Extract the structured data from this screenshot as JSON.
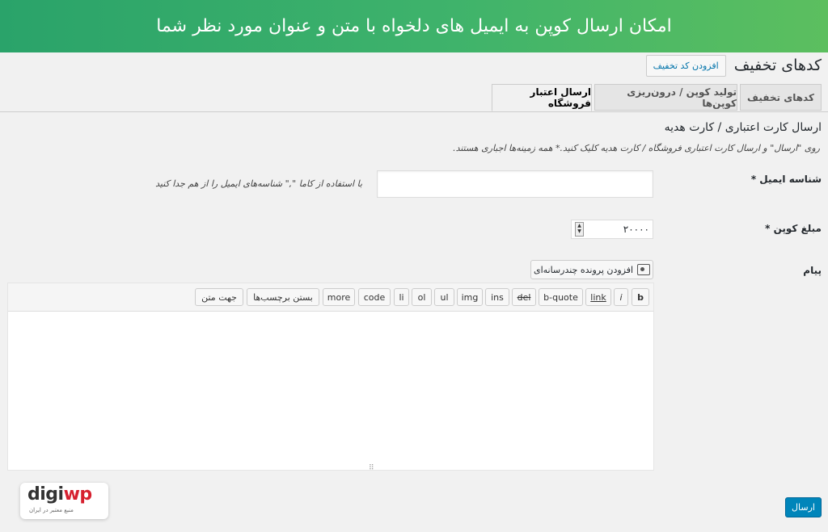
{
  "banner": {
    "text": "امکان ارسال کوپن به ایمیل های دلخواه با متن و عنوان مورد نظر شما"
  },
  "header": {
    "title": "کدهای تخفیف",
    "add_button": "افزودن کد تخفیف"
  },
  "tabs": [
    {
      "label": "کدهای تخفیف",
      "active": false
    },
    {
      "label": "تولید کوپن / درون‌ریزی کوپن‌ها",
      "active": false
    },
    {
      "label": "ارسال اعتبار فروشگاه",
      "active": true
    }
  ],
  "section": {
    "title": "ارسال کارت اعتباری / کارت هدیه",
    "description": "روی \"ارسال\" و ارسال کارت اعتباری فروشگاه / کارت هدیه کلیک کنید.* همه زمینه‌ها اجباری هستند."
  },
  "form": {
    "email": {
      "label": "شناسه ایمیل *",
      "value": "",
      "hint": "با استفاده از کاما \",\" شناسه‌های ایمیل را از هم جدا کنید"
    },
    "amount": {
      "label": "مبلغ کوپن *",
      "value": "۲۰۰۰۰"
    },
    "message": {
      "label": "پیام",
      "media_button": "افزودن پرونده چندرسانه‌ای"
    }
  },
  "quicktags": [
    "b",
    "i",
    "link",
    "b-quote",
    "del",
    "ins",
    "img",
    "ul",
    "ol",
    "li",
    "code",
    "more",
    "بستن برچسب‌ها",
    "جهت متن"
  ],
  "submit": "ارسال",
  "logo": {
    "word_main": "digi",
    "word_accent": "wp",
    "tagline": "منبع معتبر در ایران"
  },
  "colors": {
    "banner_start": "#2aa36a",
    "banner_end": "#5cbf5f",
    "primary_button": "#0085ba",
    "link": "#0073aa"
  },
  "icons": [
    "media-icon",
    "spinner-icon",
    "resize-icon"
  ]
}
